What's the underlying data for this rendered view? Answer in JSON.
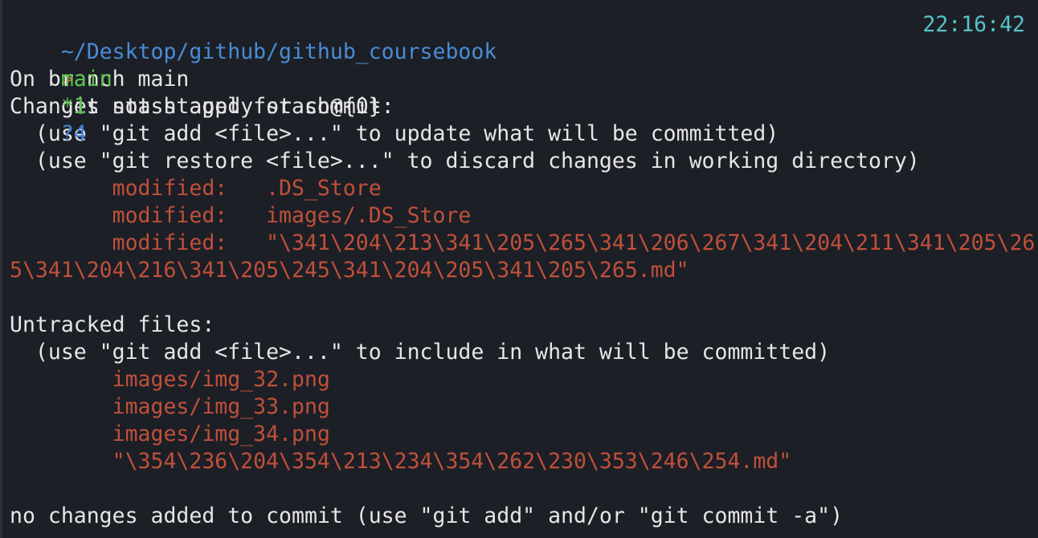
{
  "colors": {
    "background": "#1c1f26",
    "text": "#e6e6e6",
    "path": "#4a8bd6",
    "branch": "#57c24a",
    "untracked_count": "#3f86d6",
    "prompt": "#d95e3d",
    "modified": "#c0503a",
    "time": "#56c2c8"
  },
  "prompt_bar": {
    "path": "~/Desktop/github/github_coursebook",
    "branch": "main",
    "modified_count": "*1",
    "untracked_count": "?4",
    "time": "22:16:42"
  },
  "command": {
    "prompt_symbol": ">",
    "text": "git stash apply stash@{0}"
  },
  "output": {
    "on_branch": "On branch main",
    "not_staged_header": "Changes not staged for commit:",
    "hint_add": "  (use \"git add <file>...\" to update what will be committed)",
    "hint_restore": "  (use \"git restore <file>...\" to discard changes in working directory)",
    "modified": [
      "        modified:   .DS_Store",
      "        modified:   images/.DS_Store",
      "        modified:   \"\\341\\204\\213\\341\\205\\265\\341\\206\\267\\341\\204\\211\\341\\205\\26"
    ],
    "modified_wrap": "5\\341\\204\\216\\341\\205\\245\\341\\204\\205\\341\\205\\265.md\"",
    "untracked_header": "Untracked files:",
    "hint_include": "  (use \"git add <file>...\" to include in what will be committed)",
    "untracked": [
      "        images/img_32.png",
      "        images/img_33.png",
      "        images/img_34.png",
      "        \"\\354\\236\\204\\354\\213\\234\\354\\262\\230\\353\\246\\254.md\""
    ],
    "footer": "no changes added to commit (use \"git add\" and/or \"git commit -a\")"
  }
}
